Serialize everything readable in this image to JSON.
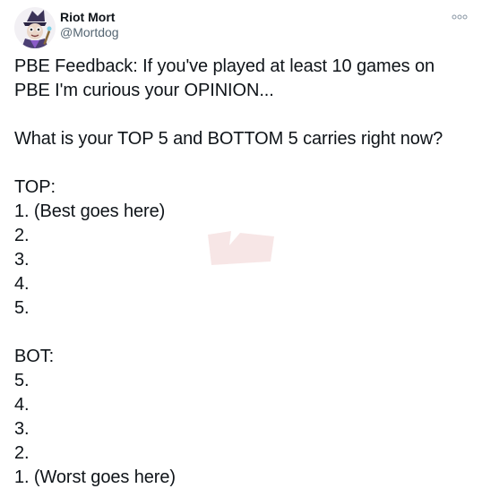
{
  "author": {
    "display_name": "Riot Mort",
    "handle": "@Mortdog",
    "avatar_icon": "avatar-character-icon"
  },
  "more_icon": "more-options-icon",
  "tweet": {
    "intro_line_1": "PBE Feedback: If you've played at least 10 games on",
    "intro_line_2": "PBE I'm curious your OPINION...",
    "question": "What is your TOP 5 and BOTTOM 5 carries right now?",
    "top_header": "TOP:",
    "top_items": [
      "1. (Best goes here)",
      "2.",
      "3.",
      "4.",
      "5."
    ],
    "bot_header": "BOT:",
    "bot_items": [
      "5.",
      "4.",
      "3.",
      "2.",
      "1. (Worst goes here)"
    ]
  },
  "colors": {
    "text_primary": "#0f1419",
    "text_secondary": "#536471",
    "watermark": "#c23b3b"
  }
}
